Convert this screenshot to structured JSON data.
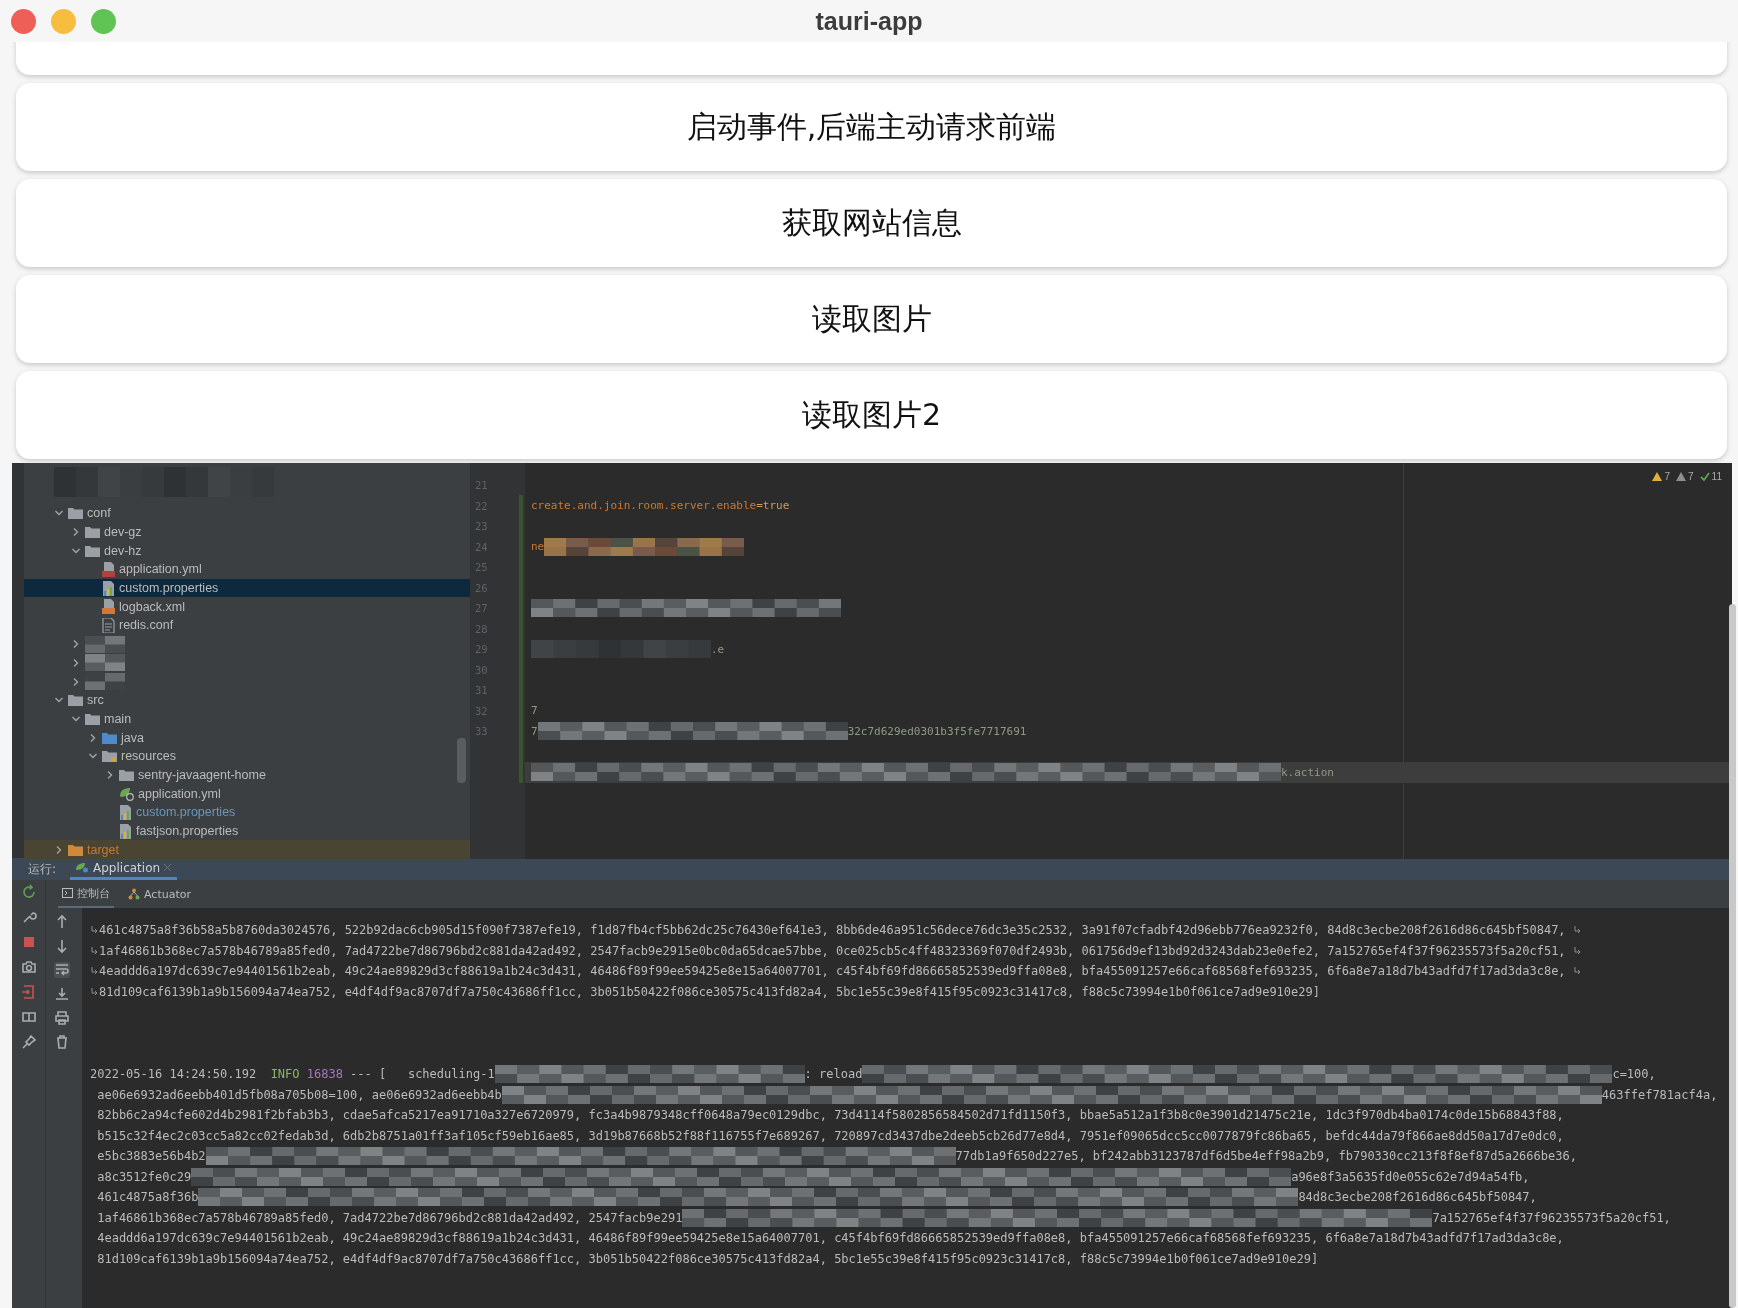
{
  "window": {
    "title": "tauri-app"
  },
  "buttons": [
    "启动事件,后端主动请求前端",
    "获取网站信息",
    "读取图片",
    "读取图片2"
  ],
  "ide_screenshot": {
    "project_tree": [
      {
        "label": "conf",
        "kind": "folder",
        "expanded": true,
        "selected": false,
        "masked": false,
        "modified": false,
        "children": [
          {
            "label": "dev-gz",
            "kind": "folder",
            "expanded": false,
            "selected": false,
            "masked": false,
            "modified": false
          },
          {
            "label": "dev-hz",
            "kind": "folder",
            "expanded": true,
            "selected": false,
            "masked": false,
            "modified": false,
            "children": [
              {
                "label": "application.yml",
                "kind": "yml",
                "selected": false,
                "masked": false,
                "modified": false
              },
              {
                "label": "custom.properties",
                "kind": "properties",
                "selected": true,
                "masked": false,
                "modified": false
              },
              {
                "label": "logback.xml",
                "kind": "xml",
                "selected": false,
                "masked": false,
                "modified": false
              },
              {
                "label": "redis.conf",
                "kind": "text",
                "selected": false,
                "masked": false,
                "modified": false
              }
            ]
          },
          {
            "kind": "folder",
            "expanded": false,
            "selected": false,
            "masked": true
          },
          {
            "kind": "folder",
            "expanded": false,
            "selected": false,
            "masked": true
          },
          {
            "kind": "folder",
            "expanded": false,
            "selected": false,
            "masked": true
          }
        ]
      },
      {
        "label": "src",
        "kind": "folder",
        "expanded": true,
        "selected": false,
        "masked": false,
        "modified": false,
        "children": [
          {
            "label": "main",
            "kind": "folder",
            "expanded": true,
            "selected": false,
            "masked": false,
            "modified": false,
            "children": [
              {
                "label": "java",
                "kind": "source-folder",
                "expanded": false,
                "selected": false,
                "masked": false,
                "modified": false
              },
              {
                "label": "resources",
                "kind": "resource-folder",
                "expanded": true,
                "selected": false,
                "masked": false,
                "modified": false,
                "children": [
                  {
                    "label": "sentry-javaagent-home",
                    "kind": "folder",
                    "expanded": false,
                    "selected": false,
                    "masked": false,
                    "modified": false
                  },
                  {
                    "label": "application.yml",
                    "kind": "spring-yml",
                    "selected": false,
                    "masked": false,
                    "modified": false
                  },
                  {
                    "label": "custom.properties",
                    "kind": "properties",
                    "selected": false,
                    "masked": false,
                    "modified": true
                  },
                  {
                    "label": "fastjson.properties",
                    "kind": "properties",
                    "selected": false,
                    "masked": false,
                    "modified": false
                  }
                ]
              }
            ]
          }
        ]
      },
      {
        "label": "target",
        "kind": "excluded-folder",
        "expanded": false,
        "selected": false,
        "masked": false,
        "modified": false
      }
    ],
    "inspections": [
      {
        "kind": "warning",
        "count": "7"
      },
      {
        "kind": "weak-warning",
        "count": "7"
      },
      {
        "kind": "ok",
        "count": "11"
      }
    ],
    "code_lines": [
      {
        "number": "21",
        "highlighted": false
      },
      {
        "number": "22",
        "highlighted": false,
        "parts": [
          {
            "kind": "key",
            "text": "create.and.join.room.server.enable"
          },
          {
            "kind": "value",
            "text": "=true"
          }
        ]
      },
      {
        "number": "23",
        "highlighted": false
      },
      {
        "number": "24",
        "highlighted": false,
        "parts": [
          {
            "kind": "key",
            "text": "ne"
          },
          {
            "kind": "mask-warm"
          }
        ]
      },
      {
        "number": "25",
        "highlighted": false
      },
      {
        "number": "26",
        "highlighted": false
      },
      {
        "number": "27",
        "highlighted": false,
        "parts": [
          {
            "kind": "mask-medium"
          }
        ]
      },
      {
        "number": "28",
        "highlighted": false
      },
      {
        "number": "29",
        "highlighted": false,
        "parts": [
          {
            "kind": "mask-small"
          },
          {
            "kind": "plain",
            "text": ".e"
          }
        ]
      },
      {
        "number": "30",
        "highlighted": false
      },
      {
        "number": "31",
        "highlighted": false
      },
      {
        "number": "32",
        "highlighted": false,
        "parts": [
          {
            "kind": "plain",
            "text": "7"
          }
        ]
      },
      {
        "number": "33",
        "highlighted": false,
        "parts": [
          {
            "kind": "plain",
            "text": "7"
          },
          {
            "kind": "mask-medium"
          },
          {
            "kind": "plain",
            "text": "32c7d629ed0301b3f5fe7717691"
          }
        ]
      },
      {
        "highlighted": false
      },
      {
        "highlighted": true,
        "parts": [
          {
            "kind": "mask-large"
          },
          {
            "kind": "plain",
            "text": "k.action"
          }
        ]
      }
    ],
    "run_panel": {
      "label": "运行:",
      "tabs": [
        {
          "label": "Application",
          "selected": true
        }
      ],
      "subtabs": [
        {
          "label": "控制台",
          "kind": "console",
          "selected": true
        },
        {
          "label": "Actuator",
          "kind": "actuator",
          "selected": false
        }
      ],
      "console_blocks": [
        {
          "lines": [
            [
              {
                "kind": "wrap"
              },
              {
                "kind": "text",
                "text": "461c4875a8f36b58a5b8760da3024576, 522b92dac6cb905d15f090f7387efe19, f1d87fb4cf5bb62dc25c76430ef641e3, 8bb6de46a951c56dece76dc3e35c2532, 3a91f07cfadbf42d96ebb776ea9232f0, 84d8c3ecbe208f2616d86c645bf50847, "
              },
              {
                "kind": "wrap"
              }
            ],
            [
              {
                "kind": "wrap"
              },
              {
                "kind": "text",
                "text": "1af46861b368ec7a578b46789a85fed0, 7ad4722be7d86796bd2c881da42ad492, 2547facb9e2915e0bc0da65dcae57bbe, 0ce025cb5c4ff48323369f070df2493b, 061756d9ef13bd92d3243dab23e0efe2, 7a152765ef4f37f96235573f5a20cf51, "
              },
              {
                "kind": "wrap"
              }
            ],
            [
              {
                "kind": "wrap"
              },
              {
                "kind": "text",
                "text": "4eaddd6a197dc639c7e94401561b2eab, 49c24ae89829d3cf88619a1b24c3d431, 46486f89f99ee59425e8e15a64007701, c45f4bf69fd86665852539ed9ffa08e8, bfa455091257e66caf68568fef693235, 6f6a8e7a18d7b43adfd7f17ad3da3c8e, "
              },
              {
                "kind": "wrap"
              }
            ],
            [
              {
                "kind": "wrap"
              },
              {
                "kind": "text",
                "text": "81d109caf6139b1a9b156094a74ea752, e4df4df9ac8707df7a750c43686ff1cc, 3b051b50422f086ce30575c413fd82a4, 5bc1e55c39e8f415f95c0923c31417c8, f88c5c73994e1b0f061ce7ad9e910e29]"
              }
            ]
          ]
        },
        {
          "lines": [
            [
              {
                "kind": "text",
                "text": "2022-05-16 14:24:50.192  "
              },
              {
                "kind": "info",
                "text": "INFO"
              },
              {
                "kind": "pid",
                "text": " 16838"
              },
              {
                "kind": "text",
                "text": " --- [   scheduling-1"
              },
              {
                "kind": "mask-medium"
              },
              {
                "kind": "text",
                "text": ": reload"
              },
              {
                "kind": "mask-large"
              },
              {
                "kind": "text",
                "text": "c=100,"
              }
            ],
            [
              {
                "kind": "text",
                "text": " ae06e6932ad6eebb401d5fb08a705b08=100, ae06e6932ad6eebb4b"
              },
              {
                "kind": "mask-huge"
              },
              {
                "kind": "text",
                "text": "463ffef781acf4a,"
              }
            ],
            [
              {
                "kind": "text",
                "text": " 82bb6c2a94cfe602d4b2981f2bfab3b3, cdae5afca5217ea91710a327e6720979, fc3a4b9879348cff0648a79ec0129dbc, 73d4114f5802856584502d71fd1150f3, bbae5a512a1f3b8c0e3901d21475c21e, 1dc3f970db4ba0174c0de15b68843f88,"
              }
            ],
            [
              {
                "kind": "text",
                "text": " b515c32f4ec2c03cc5a82cc02fedab3d, 6db2b8751a01ff3af105cf59eb16ae85, 3d19b87668b52f88f116755f7e689267, 720897cd3437dbe2deeb5cb26d77e8d4, 7951ef09065dcc5cc0077879fc86ba65, befdc44da79f866ae8dd50a17d7e0dc0,"
              }
            ],
            [
              {
                "kind": "text",
                "text": " e5bc3883e56b4b2"
              },
              {
                "kind": "mask-large"
              },
              {
                "kind": "text",
                "text": "77db1a9f650d227e5, bf242abb3123787df6d5be4eff98a2b9, fb790330cc213f8f8ef87d5a2666be36,"
              }
            ],
            [
              {
                "kind": "text",
                "text": " a8c3512fe0c29"
              },
              {
                "kind": "mask-huge"
              },
              {
                "kind": "text",
                "text": "a96e8f3a5635fd0e055c62e7d94a54fb,"
              }
            ],
            [
              {
                "kind": "text",
                "text": " 461c4875a8f36b"
              },
              {
                "kind": "mask-huge"
              },
              {
                "kind": "text",
                "text": "84d8c3ecbe208f2616d86c645bf50847,"
              }
            ],
            [
              {
                "kind": "text",
                "text": " 1af46861b368ec7a578b46789a85fed0, 7ad4722be7d86796bd2c881da42ad492, 2547facb9e291"
              },
              {
                "kind": "mask-large"
              },
              {
                "kind": "text",
                "text": "7a152765ef4f37f96235573f5a20cf51,"
              }
            ],
            [
              {
                "kind": "text",
                "text": " 4eaddd6a197dc639c7e94401561b2eab, 49c24ae89829d3cf88619a1b24c3d431, 46486f89f99ee59425e8e15a64007701, c45f4bf69fd86665852539ed9ffa08e8, bfa455091257e66caf68568fef693235, 6f6a8e7a18d7b43adfd7f17ad3da3c8e,"
              }
            ],
            [
              {
                "kind": "text",
                "text": " 81d109caf6139b1a9b156094a74ea752, e4df4df9ac8707df7a750c43686ff1cc, 3b051b50422f086ce30575c413fd82a4, 5bc1e55c39e8f415f95c0923c31417c8, f88c5c73994e1b0f061ce7ad9e910e29]"
              }
            ]
          ]
        }
      ]
    }
  }
}
